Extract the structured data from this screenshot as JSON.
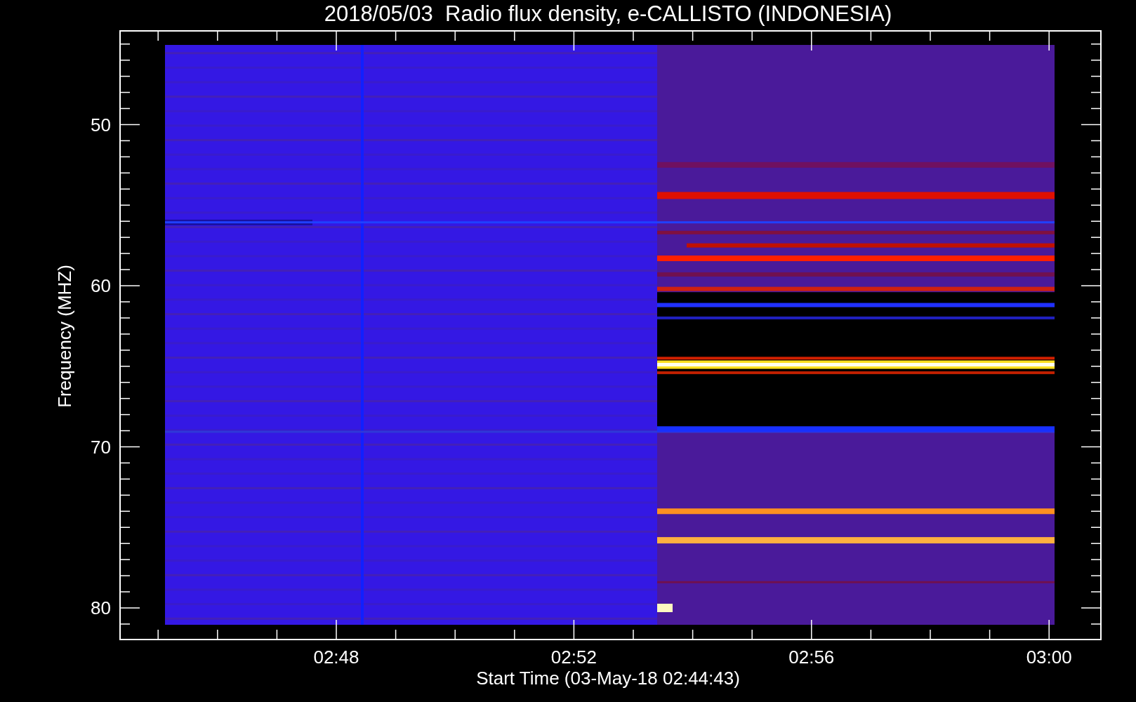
{
  "title": "2018/05/03  Radio flux density, e-CALLISTO (INDONESIA)",
  "ylabel": "Frequency (MHZ)",
  "xlabel": "Start Time (03-May-18 02:44:43)",
  "yticks": [
    "50",
    "60",
    "70",
    "80"
  ],
  "xticks": [
    "02:48",
    "02:52",
    "02:56",
    "03:00"
  ]
}
